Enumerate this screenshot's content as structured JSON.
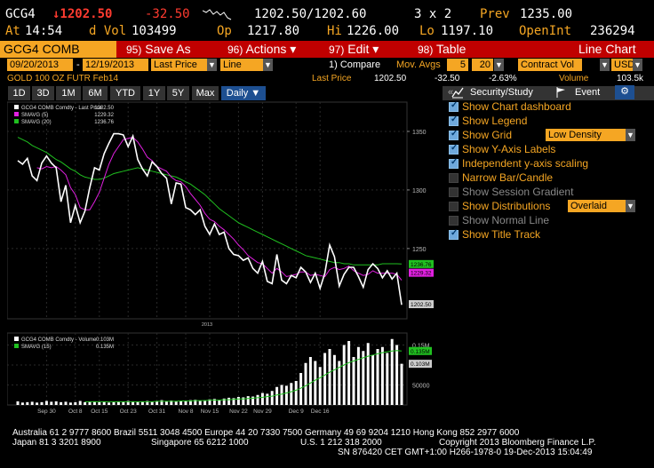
{
  "quote": {
    "ticker": "GCG4",
    "last": "↓1202.50",
    "change": "-32.50",
    "bidask": "1202.50/1202.60",
    "size": "3 x 2",
    "prev_label": "Prev",
    "prev": "1235.00",
    "time_label": "At",
    "time": "14:54",
    "dvol_label": "d Vol",
    "dvol": "103499",
    "op_label": "Op",
    "op": "1217.80",
    "hi_label": "Hi",
    "hi": "1226.00",
    "lo_label": "Lo",
    "lo": "1197.10",
    "openint_label": "OpenInt",
    "openint": "236294"
  },
  "cmdbar": {
    "security": "GCG4 COMB Comdt",
    "buttons": [
      {
        "num": "95)",
        "label": "Save As"
      },
      {
        "num": "96)",
        "label": "Actions ▾"
      },
      {
        "num": "97)",
        "label": "Edit ▾"
      },
      {
        "num": "98)",
        "label": "Table"
      }
    ],
    "chart_type": "Line Chart"
  },
  "params": {
    "start_date": "09/20/2013",
    "end_date": "12/19/2013",
    "field": "Last Price",
    "style": "Line",
    "compare": "1) Compare",
    "mov_avgs_label": "Mov. Avgs",
    "mavg1": "5",
    "mavg2": "20",
    "volume_field": "Contract Vol",
    "currency": "USD"
  },
  "info": {
    "security_desc": "GOLD 100 OZ FUTR  Feb14",
    "field": "Last Price",
    "value": "1202.50",
    "change": "-32.50",
    "pct": "-2.63%",
    "vol_label": "Volume",
    "vol": "103.5k"
  },
  "tabs": [
    "1D",
    "3D",
    "1M",
    "6M",
    "YTD",
    "1Y",
    "5Y",
    "Max",
    "Daily ▼"
  ],
  "rpanel": {
    "tabs": [
      "Security/Study",
      "Event"
    ],
    "options": [
      {
        "label": "Show Chart dashboard",
        "checked": true,
        "enabled": true
      },
      {
        "label": "Show Legend",
        "checked": true,
        "enabled": true
      },
      {
        "label": "Show Grid",
        "checked": true,
        "enabled": true,
        "select": "Low Density"
      },
      {
        "label": "Show Y-Axis Labels",
        "checked": true,
        "enabled": true
      },
      {
        "label": "Independent y-axis scaling",
        "checked": true,
        "enabled": true
      },
      {
        "label": "Narrow Bar/Candle",
        "checked": false,
        "enabled": true
      },
      {
        "label": "Show Session Gradient",
        "checked": false,
        "enabled": false
      },
      {
        "label": "Show Distributions",
        "checked": false,
        "enabled": true,
        "select": "Overlaid"
      },
      {
        "label": "Show Normal Line",
        "checked": false,
        "enabled": false
      },
      {
        "label": "Show Title Track",
        "checked": true,
        "enabled": true
      }
    ]
  },
  "chart_data": {
    "type": "line",
    "price_panel": {
      "legend": [
        {
          "name": "GCG4 COMB Comdty - Last Price",
          "value": "1202.50",
          "color": "#ffffff"
        },
        {
          "name": "SMAVG (5)",
          "value": "1229.32",
          "color": "#e020e0"
        },
        {
          "name": "SMAVG (20)",
          "value": "1236.76",
          "color": "#20c020"
        }
      ],
      "yticks": [
        1250,
        1300,
        1350
      ],
      "ylim": [
        1190,
        1375
      ],
      "last_tags": [
        {
          "value": "1236.76",
          "y": 1236.76,
          "color": "#20c020"
        },
        {
          "value": "1229.32",
          "y": 1229.32,
          "color": "#e020e0"
        },
        {
          "value": "1202.50",
          "y": 1202.5,
          "color": "#cccccc"
        }
      ],
      "series": {
        "last": [
          1325,
          1322,
          1327,
          1312,
          1308,
          1323,
          1329,
          1323,
          1319,
          1290,
          1304,
          1272,
          1287,
          1272,
          1282,
          1302,
          1319,
          1317,
          1331,
          1340,
          1348,
          1348,
          1347,
          1337,
          1346,
          1326,
          1318,
          1312,
          1324,
          1320,
          1314,
          1310,
          1288,
          1306,
          1305,
          1285,
          1283,
          1279,
          1283,
          1269,
          1262,
          1271,
          1262,
          1264,
          1250,
          1245,
          1244,
          1240,
          1242,
          1233,
          1229,
          1239,
          1222,
          1220,
          1245,
          1223,
          1220,
          1227,
          1225,
          1234,
          1230,
          1221,
          1229,
          1216,
          1229,
          1253,
          1243,
          1218,
          1228,
          1234,
          1234,
          1226,
          1217,
          1232,
          1237,
          1233,
          1225,
          1231,
          1224,
          1229,
          1202
        ],
        "smavg5": [
          null,
          null,
          null,
          null,
          1319,
          1318,
          1320,
          1319,
          1320,
          1317,
          1313,
          1302,
          1296,
          1285,
          1283,
          1283,
          1290,
          1298,
          1310,
          1322,
          1331,
          1337,
          1343,
          1344,
          1345,
          1341,
          1335,
          1328,
          1325,
          1320,
          1318,
          1316,
          1311,
          1308,
          1307,
          1303,
          1297,
          1292,
          1287,
          1280,
          1275,
          1273,
          1269,
          1266,
          1262,
          1258,
          1253,
          1249,
          1244,
          1241,
          1238,
          1237,
          1233,
          1229,
          1233,
          1230,
          1226,
          1227,
          1228,
          1230,
          1230,
          1227,
          1228,
          1227,
          1226,
          1232,
          1234,
          1232,
          1233,
          1235,
          1231,
          1229,
          1227,
          1228,
          1231,
          1229,
          1229,
          1229,
          1229,
          1228,
          1223
        ],
        "smavg20": [
          1345,
          1343,
          1341,
          1338,
          1336,
          1334,
          1332,
          1329,
          1326,
          1324,
          1321,
          1318,
          1316,
          1313,
          1311,
          1310,
          1309,
          1309,
          1310,
          1312,
          1314,
          1315,
          1316,
          1317,
          1318,
          1319,
          1318,
          1317,
          1316,
          1315,
          1314,
          1313,
          1312,
          1311,
          1309,
          1307,
          1305,
          1302,
          1299,
          1296,
          1292,
          1288,
          1284,
          1281,
          1278,
          1275,
          1272,
          1270,
          1268,
          1266,
          1264,
          1262,
          1260,
          1258,
          1256,
          1254,
          1252,
          1250,
          1248,
          1246,
          1244,
          1243,
          1242,
          1241,
          1240,
          1239,
          1238,
          1238,
          1237,
          1237,
          1236,
          1236,
          1236,
          1236,
          1236,
          1236,
          1237,
          1237,
          1237,
          1237,
          1236.8
        ]
      }
    },
    "volume_panel": {
      "legend": [
        {
          "name": "GCG4 COMB Comdty - Volume",
          "value": "0.103M",
          "color": "#ffffff"
        },
        {
          "name": "SMAVG (15)",
          "value": "0.135M",
          "color": "#20c020"
        }
      ],
      "yticks": [
        "50000",
        "0.10M",
        "0.15M"
      ],
      "ylim": [
        0,
        180000
      ],
      "last_tags": [
        {
          "value": "0.135M",
          "y": 135000,
          "color": "#20c020"
        },
        {
          "value": "0.103M",
          "y": 103000,
          "color": "#cccccc"
        }
      ],
      "values": [
        9000,
        6000,
        7000,
        8000,
        6000,
        7000,
        10000,
        8000,
        9000,
        7000,
        8000,
        6000,
        7000,
        10000,
        7000,
        8000,
        9000,
        7000,
        8000,
        6000,
        7000,
        9000,
        8000,
        10000,
        9000,
        8000,
        9000,
        10000,
        8000,
        9000,
        12000,
        10000,
        11000,
        9000,
        10000,
        11000,
        12000,
        13000,
        11000,
        12000,
        14000,
        15000,
        13000,
        16000,
        18000,
        17000,
        20000,
        19000,
        22000,
        21000,
        25000,
        30000,
        28000,
        35000,
        45000,
        50000,
        48000,
        55000,
        60000,
        80000,
        105000,
        120000,
        110000,
        95000,
        130000,
        140000,
        125000,
        110000,
        150000,
        160000,
        120000,
        145000,
        135000,
        155000,
        125000,
        140000,
        145000,
        130000,
        165000,
        150000,
        103000
      ],
      "smavg15": [
        null,
        null,
        null,
        null,
        null,
        null,
        null,
        null,
        null,
        null,
        null,
        null,
        null,
        null,
        8000,
        8000,
        8000,
        8000,
        8000,
        8000,
        8000,
        8000,
        8000,
        8000,
        8000,
        8000,
        8000,
        8000,
        8000,
        9000,
        9000,
        9000,
        9000,
        9000,
        10000,
        10000,
        10000,
        11000,
        11000,
        11000,
        12000,
        12000,
        12000,
        13000,
        13000,
        14000,
        15000,
        15000,
        16000,
        17000,
        18000,
        19000,
        21000,
        22000,
        25000,
        27000,
        30000,
        33000,
        37000,
        42000,
        48000,
        55000,
        62000,
        68000,
        75000,
        82000,
        88000,
        94000,
        100000,
        106000,
        110000,
        114000,
        118000,
        122000,
        125000,
        128000,
        131000,
        133000,
        135000,
        136000,
        135000
      ]
    },
    "x_labels": [
      "Sep 30",
      "Oct 8",
      "Oct 15",
      "Oct 23",
      "Oct 31",
      "Nov 8",
      "Nov 15",
      "Nov 22",
      "Nov 29",
      "Dec 9",
      "Dec 16"
    ],
    "x_label_index": [
      6,
      12,
      17,
      23,
      29,
      35,
      40,
      46,
      51,
      58,
      63
    ],
    "year_label": "2013",
    "grid": true
  },
  "footer": {
    "line1": "Australia 61 2 9777 8600 Brazil 5511 3048 4500 Europe 44 20 7330 7500 Germany 49 69 9204 1210 Hong Kong 852 2977 6000",
    "line2a": "Japan 81 3 3201 8900",
    "line2b": "Singapore 65 6212 1000",
    "line2c": "U.S. 1 212 318 2000",
    "line2d": "Copyright 2013 Bloomberg Finance L.P.",
    "line3": "SN 876420 CET  GMT+1:00 H266-1978-0 19-Dec-2013 15:04:49"
  }
}
